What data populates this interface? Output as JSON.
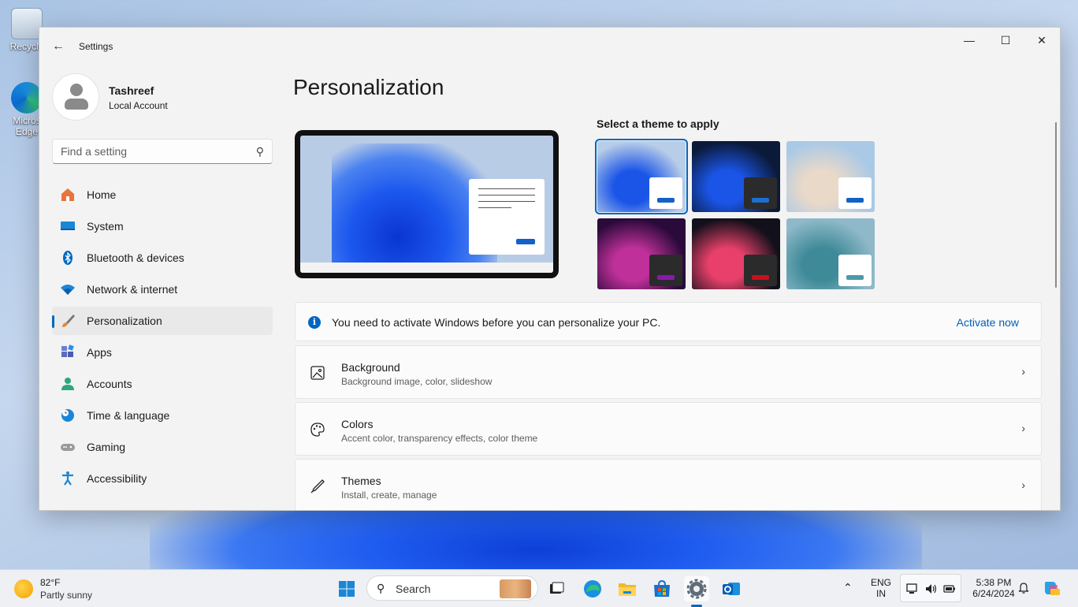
{
  "desktop": {
    "icons": [
      {
        "label": "Recycle",
        "icon": "recycle-bin-icon"
      },
      {
        "label": "Micros Edge",
        "icon": "edge-icon"
      }
    ]
  },
  "window": {
    "title": "Settings",
    "controls": {
      "minimize": "—",
      "maximize": "☐",
      "close": "✕"
    }
  },
  "profile": {
    "name": "Tashreef",
    "account": "Local Account"
  },
  "search": {
    "placeholder": "Find a setting"
  },
  "sidebar": {
    "items": [
      {
        "label": "Home",
        "icon": "home-icon",
        "color": "#e8743b"
      },
      {
        "label": "System",
        "icon": "display-icon",
        "color": "#1a86d6"
      },
      {
        "label": "Bluetooth & devices",
        "icon": "bluetooth-icon",
        "color": "#0067c0"
      },
      {
        "label": "Network & internet",
        "icon": "wifi-icon",
        "color": "#1a86d6"
      },
      {
        "label": "Personalization",
        "icon": "brush-icon",
        "color": "#e58a3a",
        "active": true
      },
      {
        "label": "Apps",
        "icon": "apps-icon",
        "color": "#5b6cbf"
      },
      {
        "label": "Accounts",
        "icon": "person-icon",
        "color": "#2aa87e"
      },
      {
        "label": "Time & language",
        "icon": "globe-clock-icon",
        "color": "#1a86d6"
      },
      {
        "label": "Gaming",
        "icon": "gamepad-icon",
        "color": "#8a8a8a"
      },
      {
        "label": "Accessibility",
        "icon": "accessibility-icon",
        "color": "#1a86d6"
      }
    ]
  },
  "main": {
    "title": "Personalization",
    "theme_heading": "Select a theme to apply",
    "themes": [
      {
        "name": "windows-light",
        "bg": "#b8cde8",
        "bloom": "#1a55e8",
        "win": "#ffffff",
        "bar": "#1261c8",
        "selected": true
      },
      {
        "name": "windows-dark",
        "bg": "#0b1a38",
        "bloom": "#1a55e8",
        "win": "#2b2b2b",
        "bar": "#1a6fd0"
      },
      {
        "name": "spotlight",
        "bg": "#a9c9e6",
        "bloom": "#e9d9c9",
        "win": "#ffffff",
        "bar": "#1261c8"
      },
      {
        "name": "glow",
        "bg": "#2a0a3a",
        "bloom": "#c0309a",
        "win": "#2b2b2b",
        "bar": "#8a18b0"
      },
      {
        "name": "captured-motion",
        "bg": "#12101a",
        "bloom": "#e8406a",
        "win": "#2b2b2b",
        "bar": "#c8101a"
      },
      {
        "name": "flow",
        "bg": "#8fb9c9",
        "bloom": "#3e8a98",
        "win": "#ffffff",
        "bar": "#4a9aaa"
      }
    ],
    "banner": {
      "message": "You need to activate Windows before you can personalize your PC.",
      "action": "Activate now"
    },
    "cards": [
      {
        "title": "Background",
        "subtitle": "Background image, color, slideshow",
        "icon": "image-icon"
      },
      {
        "title": "Colors",
        "subtitle": "Accent color, transparency effects, color theme",
        "icon": "palette-icon"
      },
      {
        "title": "Themes",
        "subtitle": "Install, create, manage",
        "icon": "pen-brush-icon"
      }
    ]
  },
  "taskbar": {
    "weather": {
      "temp": "82°F",
      "condition": "Partly sunny"
    },
    "search_label": "Search",
    "lang": {
      "line1": "ENG",
      "line2": "IN"
    },
    "clock": {
      "time": "5:38 PM",
      "date": "6/24/2024"
    },
    "apps": [
      {
        "icon": "start-icon"
      },
      {
        "icon": "task-view-icon"
      },
      {
        "icon": "edge-icon"
      },
      {
        "icon": "file-explorer-icon"
      },
      {
        "icon": "store-icon"
      },
      {
        "icon": "settings-icon"
      },
      {
        "icon": "outlook-icon"
      }
    ]
  }
}
